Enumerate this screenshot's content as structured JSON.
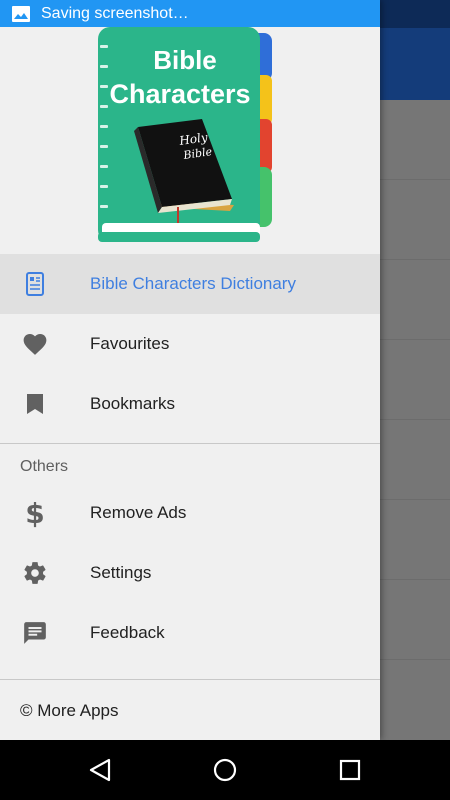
{
  "status": {
    "notification_text": "Saving screenshot…"
  },
  "header": {
    "logo_title_line1": "Bible",
    "logo_title_line2": "Characters",
    "book_text_line1": "Holy",
    "book_text_line2": "Bible"
  },
  "menu": {
    "items": [
      {
        "label": "Bible Characters Dictionary",
        "icon": "dictionary-icon",
        "active": true
      },
      {
        "label": "Favourites",
        "icon": "heart-icon",
        "active": false
      },
      {
        "label": "Bookmarks",
        "icon": "bookmark-icon",
        "active": false
      }
    ],
    "section_label": "Others",
    "other_items": [
      {
        "label": "Remove Ads",
        "icon": "dollar-icon"
      },
      {
        "label": "Settings",
        "icon": "gear-icon"
      },
      {
        "label": "Feedback",
        "icon": "feedback-icon"
      }
    ],
    "footer_label": "© More Apps"
  },
  "colors": {
    "accent": "#3f7fe0",
    "notification_bar": "#2196f3",
    "toolbar": "#143c7a",
    "logo_green": "#2bb58a"
  }
}
